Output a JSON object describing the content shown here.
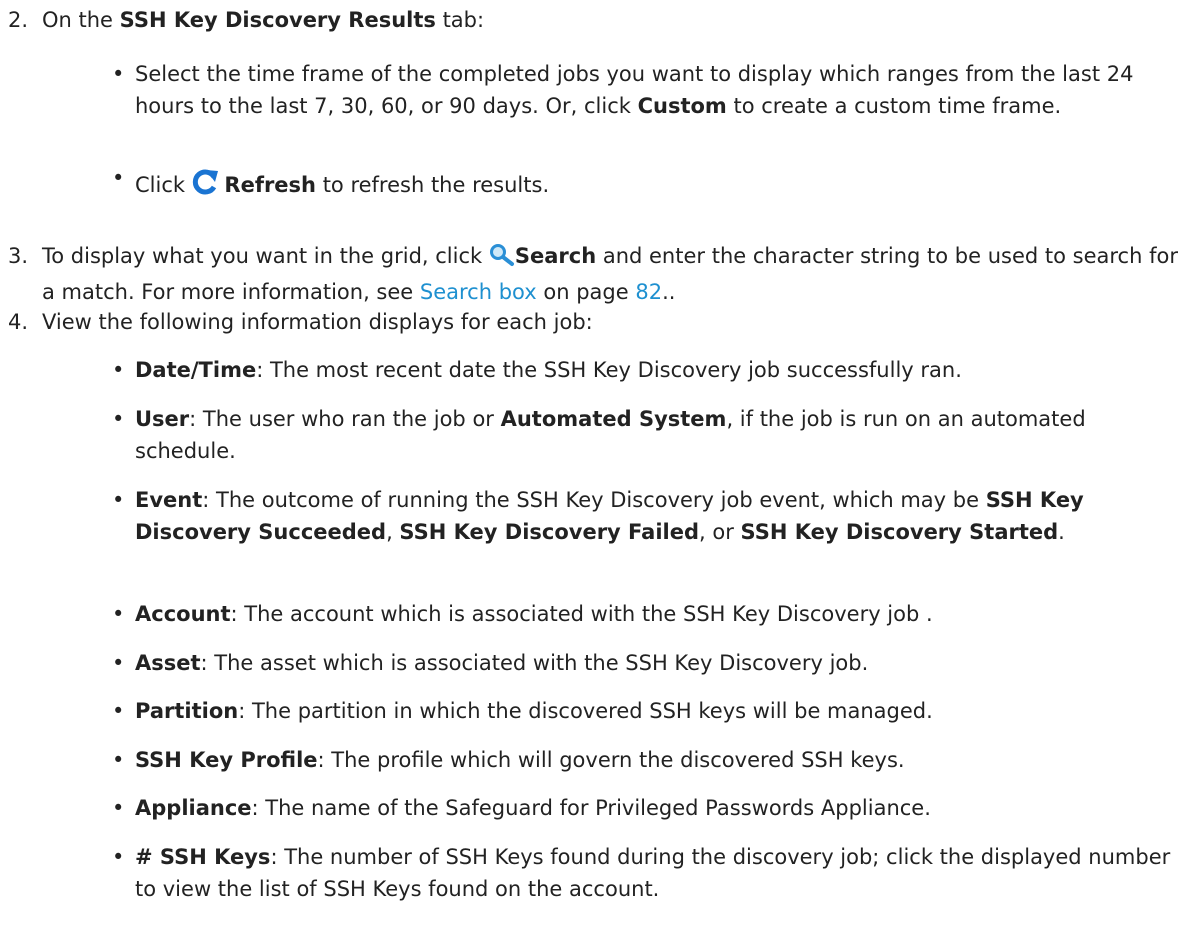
{
  "step2": {
    "num": "2.",
    "pre": "On the ",
    "tab": "SSH Key Discovery Results",
    "post": " tab:",
    "b1": {
      "text": "Select the time frame of the completed jobs you want to display which ranges from the last 24 hours to the last 7, 30, 60, or 90 days. Or, click ",
      "custom": "Custom",
      "post": " to create a custom time frame."
    },
    "b2": {
      "pre": "Click ",
      "refresh": "Refresh",
      "post": " to refresh the results.",
      "icon": "refresh-icon",
      "icon_color": "#1a74d2"
    }
  },
  "step3": {
    "num": "3.",
    "pre": "To display what you want in the grid, click ",
    "search": "Search",
    "mid": " and enter the character string to be used to search for a match. For more information, see ",
    "link": "Search box",
    "on_page": " on page ",
    "page": "82",
    "end": "..",
    "icon": "search-icon",
    "link_color": "#1e90d0"
  },
  "step4": {
    "num": "4.",
    "intro": "View the following information displays for each job:",
    "items": [
      {
        "term": "Date/Time",
        "desc": ": The most recent date the SSH Key Discovery job successfully ran."
      },
      {
        "term": "User",
        "desc": ": The user who ran the job or ",
        "b2": "Automated System",
        "desc2": ", if the job is run on an automated schedule."
      },
      {
        "term": "Event",
        "desc": ": The outcome of running the SSH Key Discovery job event, which may be ",
        "b2": "SSH Key Discovery Succeeded",
        "desc2": ", ",
        "b3": "SSH Key Discovery Failed",
        "desc3": ", or ",
        "b4": "SSH Key Discovery Started",
        "desc4": "."
      },
      {
        "term": "Account",
        "desc": ": The account which is associated with the SSH Key Discovery job ."
      },
      {
        "term": "Asset",
        "desc": ": The asset which is associated with the SSH Key Discovery job."
      },
      {
        "term": "Partition",
        "desc": ": The partition in which the discovered SSH keys will be managed."
      },
      {
        "term": "SSH Key Profile",
        "desc": ": The profile which will govern the discovered SSH keys."
      },
      {
        "term": "Appliance",
        "desc": ": The name of the Safeguard for Privileged Passwords Appliance."
      },
      {
        "term": "# SSH Keys",
        "desc": ": The number of SSH Keys found during the discovery job; click the displayed number to view the list of SSH Keys found on the account."
      }
    ]
  }
}
